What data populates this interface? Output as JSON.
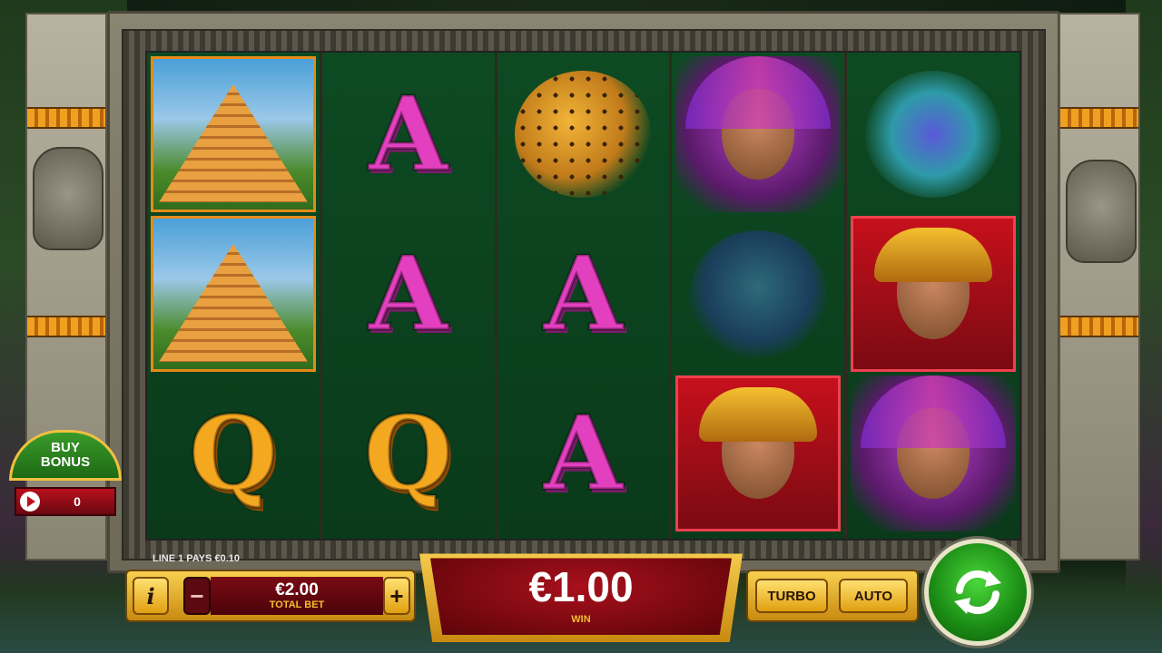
{
  "bonus": {
    "buy_label_line1": "BUY",
    "buy_label_line2": "BONUS",
    "count": "0"
  },
  "reels": [
    {
      "symbols": [
        "pyramid",
        "pyramid",
        "Q"
      ]
    },
    {
      "symbols": [
        "A",
        "A",
        "Q"
      ]
    },
    {
      "symbols": [
        "jaguar",
        "A",
        "A"
      ]
    },
    {
      "symbols": [
        "princess",
        "monkey",
        "warrior"
      ]
    },
    {
      "symbols": [
        "serpent",
        "warrior",
        "princess"
      ]
    }
  ],
  "letters": {
    "a": "A",
    "q": "Q"
  },
  "line_pays": "LINE 1 PAYS €0.10",
  "bet": {
    "value": "€2.00",
    "label": "TOTAL BET",
    "info": "i",
    "minus": "−",
    "plus": "+"
  },
  "win": {
    "value": "€1.00",
    "label": "WIN"
  },
  "controls": {
    "turbo": "TURBO",
    "auto": "AUTO"
  },
  "colors": {
    "letter_a": "#e340c0",
    "letter_q": "#f4a820",
    "spin_green": "#1a8a14",
    "gold": "#f8d050",
    "panel_red": "#7a0a14"
  }
}
